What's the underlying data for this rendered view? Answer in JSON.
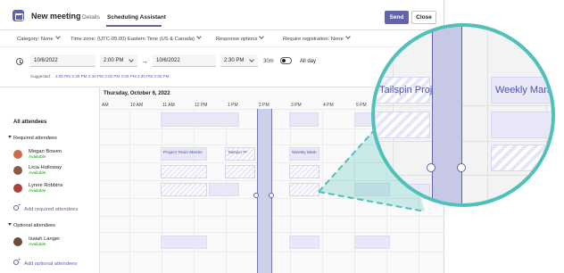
{
  "window": {
    "title": "New meeting",
    "tabs": [
      "Details",
      "Scheduling Assistant"
    ],
    "send_label": "Send",
    "close_label": "Close"
  },
  "options": {
    "category": "Category: None",
    "timezone": "Time zone: (UTC-05:00) Eastern Time (US & Canada)",
    "response": "Response options",
    "registration": "Require registration: None"
  },
  "dates": {
    "start_date": "10/6/2022",
    "start_time": "2:00 PM",
    "end_date": "10/6/2022",
    "end_time": "2:30 PM",
    "duration": "30m",
    "all_day_label": "All day",
    "suggested_label": "Suggested:",
    "suggested": "2:00 PM  2:30 PM  2:30 PM  3:00 PM  3:00 PM  3:30 PM  3:30 PM"
  },
  "grid": {
    "day_header": "Thursday, October 6, 2022",
    "hours": [
      "AM",
      "10 AM",
      "11 AM",
      "12 PM",
      "1 PM",
      "2 PM",
      "3 PM",
      "4 PM",
      "5 PM"
    ],
    "all_attendees": "All attendees",
    "required_header": "Required attendees",
    "optional_header": "Optional attendees",
    "add_required": "Add required attendees",
    "add_optional": "Add optional attendees",
    "events": {
      "project_team": "Project Team Meetin",
      "tailspin": "Tailspin Pr",
      "weekly": "Weekly Mark"
    }
  },
  "people": [
    {
      "name": "Megan Bowen",
      "status": "Available"
    },
    {
      "name": "Licia Holloway",
      "status": "Available"
    },
    {
      "name": "Lynne Robbins",
      "status": "Available"
    },
    {
      "name": "Isaiah Langer",
      "status": "Available"
    }
  ],
  "zoom": {
    "tailspin": "Tailspin Proje",
    "weekly": "Weekly Mark"
  },
  "colors": {
    "accent": "#6264a7",
    "teal": "#4fc1b8",
    "available": "#13a10e"
  }
}
